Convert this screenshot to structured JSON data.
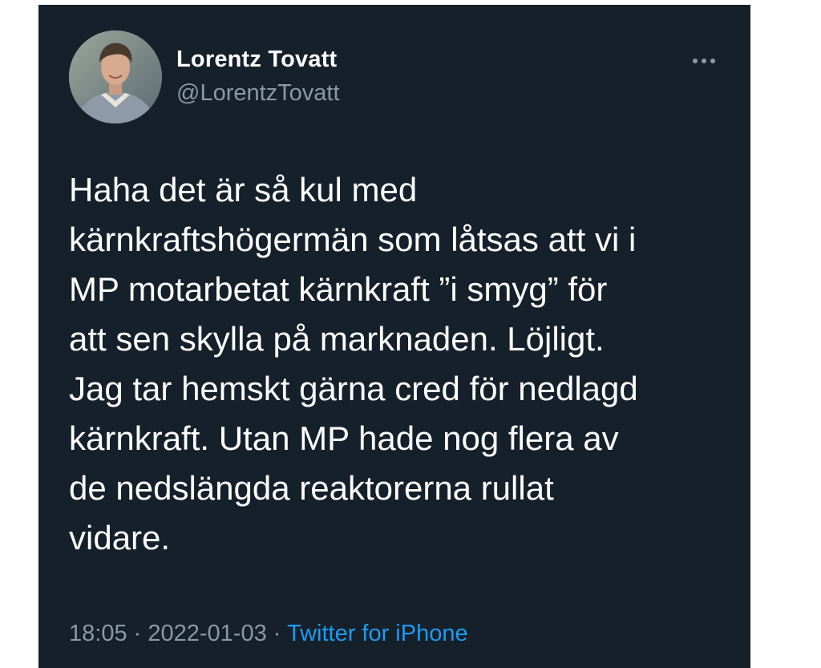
{
  "tweet": {
    "author": {
      "display_name": "Lorentz Tovatt",
      "handle": "@LorentzTovatt"
    },
    "text": "Haha det är så kul med\nkärnkraftshögermän som låtsas att vi i\nMP motarbetat kärnkraft ”i smyg” för\natt sen skylla på marknaden. Löjligt.\nJag tar hemskt gärna cred för nedlagd\nkärnkraft. Utan MP hade nog flera av\nde nedslängda reaktorerna rullat\nvidare.",
    "meta": {
      "time": "18:05",
      "separator_1": " · ",
      "date": "2022-01-03",
      "separator_2": " · ",
      "source": "Twitter for iPhone"
    },
    "icons": {
      "more": "more-horizontal-icon"
    },
    "colors": {
      "background": "#15202b",
      "text": "#ffffff",
      "secondary": "#8b98a5",
      "link": "#1d9bf0"
    }
  }
}
